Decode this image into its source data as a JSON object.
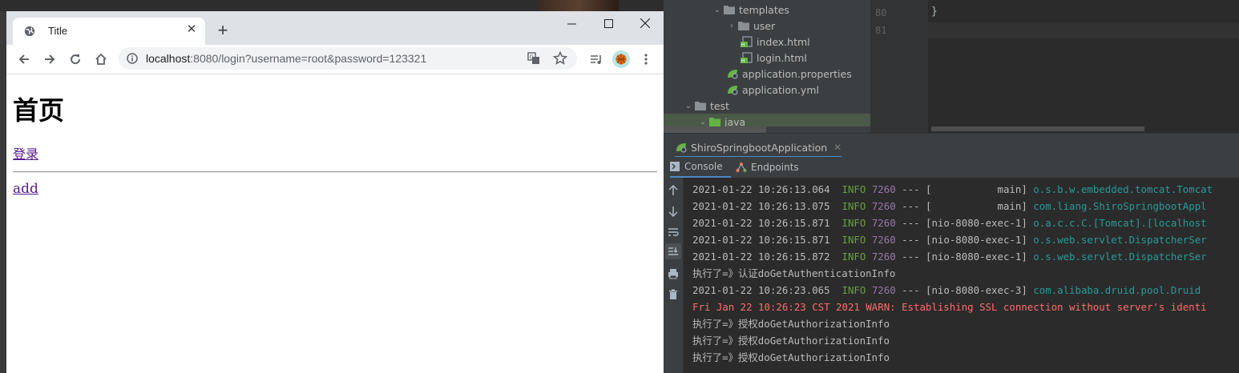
{
  "browser": {
    "tab_title": "Title",
    "url_host": "localhost",
    "url_rest": ":8080/login?username=root&password=123321"
  },
  "page": {
    "heading": "首页",
    "login_link": "登录",
    "add_link": "add"
  },
  "ide": {
    "tree": [
      {
        "label": "templates",
        "type": "folder",
        "expanded": true
      },
      {
        "label": "user",
        "type": "folder",
        "expanded": false
      },
      {
        "label": "index.html",
        "type": "html-file"
      },
      {
        "label": "login.html",
        "type": "html-file"
      },
      {
        "label": "application.properties",
        "type": "spring-config"
      },
      {
        "label": "application.yml",
        "type": "spring-config"
      },
      {
        "label": "test",
        "type": "folder",
        "expanded": true
      },
      {
        "label": "java",
        "type": "folder-source",
        "expanded": true
      }
    ],
    "editor": {
      "line_numbers": [
        "80",
        "81"
      ],
      "code_brace": "}"
    },
    "run_config": "ShiroSpringbootApplication",
    "console_tabs": [
      "Console",
      "Endpoints"
    ],
    "log": [
      {
        "ts": "2021-01-22 10:26:13.064",
        "level": "INFO",
        "pid": "7260",
        "sep": "---",
        "thread": "[           main]",
        "logger": "o.s.b.w.embedded.tomcat.Tomcat"
      },
      {
        "ts": "2021-01-22 10:26:13.075",
        "level": "INFO",
        "pid": "7260",
        "sep": "---",
        "thread": "[           main]",
        "logger": "com.liang.ShiroSpringbootAppl"
      },
      {
        "ts": "2021-01-22 10:26:15.871",
        "level": "INFO",
        "pid": "7260",
        "sep": "---",
        "thread": "[nio-8080-exec-1]",
        "logger": "o.a.c.c.C.[Tomcat].[localhost"
      },
      {
        "ts": "2021-01-22 10:26:15.871",
        "level": "INFO",
        "pid": "7260",
        "sep": "---",
        "thread": "[nio-8080-exec-1]",
        "logger": "o.s.web.servlet.DispatcherSer"
      },
      {
        "ts": "2021-01-22 10:26:15.872",
        "level": "INFO",
        "pid": "7260",
        "sep": "---",
        "thread": "[nio-8080-exec-1]",
        "logger": "o.s.web.servlet.DispatcherSer"
      },
      {
        "plain": "执行了=》认证doGetAuthenticationInfo"
      },
      {
        "ts": "2021-01-22 10:26:23.065",
        "level": "INFO",
        "pid": "7260",
        "sep": "---",
        "thread": "[nio-8080-exec-3]",
        "logger": "com.alibaba.druid.pool.Druid"
      },
      {
        "warn": "Fri Jan 22 10:26:23 CST 2021 WARN: Establishing SSL connection without server's identi"
      },
      {
        "plain": "执行了=》授权doGetAuthorizationInfo"
      },
      {
        "plain": "执行了=》授权doGetAuthorizationInfo"
      },
      {
        "plain": "执行了=》授权doGetAuthorizationInfo"
      }
    ]
  },
  "colors": {
    "info": "#6a9f43",
    "pid": "#9876aa",
    "logger": "#299999",
    "warn": "#ff6b68",
    "link_visited": "#551a8b"
  }
}
